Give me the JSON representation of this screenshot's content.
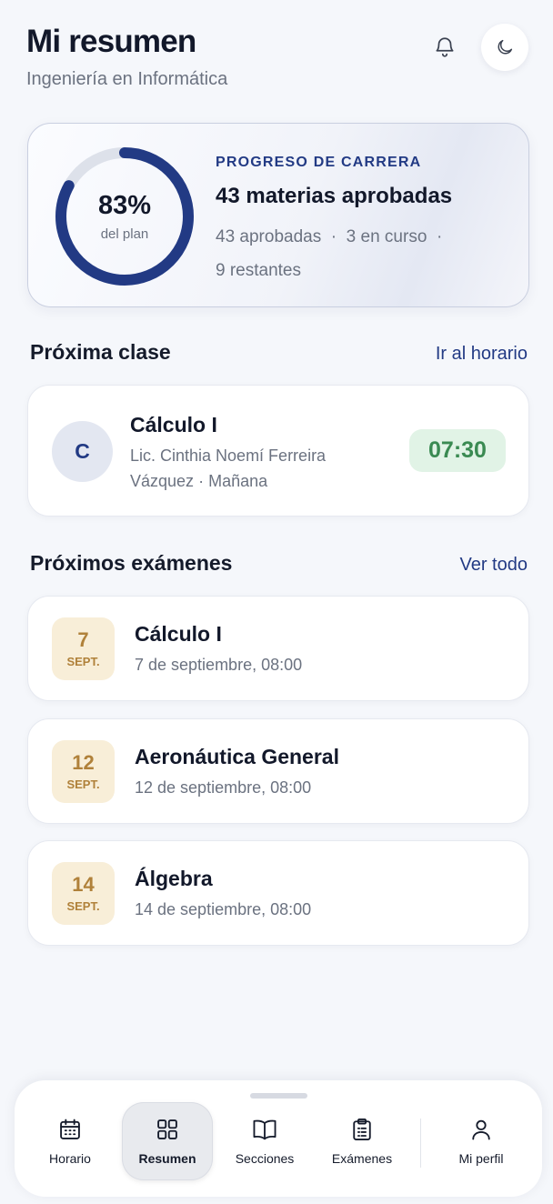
{
  "header": {
    "title": "Mi resumen",
    "subtitle": "Ingeniería en Informática",
    "bell_icon": "bell-icon",
    "theme_icon": "moon-icon"
  },
  "progress": {
    "percent_label": "83%",
    "percent_value": 83,
    "ring_caption": "del plan",
    "eyebrow": "PROGRESO DE CARRERA",
    "title": "43 materias aprobadas",
    "approved": "43 aprobadas",
    "in_course": "3 en curso",
    "remaining": "9 restantes",
    "separator": "·"
  },
  "next_class": {
    "section_title": "Próxima clase",
    "link": "Ir al horario",
    "initial": "C",
    "course": "Cálculo I",
    "teacher": "Lic. Cinthia Noemí Ferreira Vázquez",
    "shift": "Mañana",
    "separator": "·",
    "time": "07:30"
  },
  "exams": {
    "section_title": "Próximos exámenes",
    "link": "Ver todo",
    "items": [
      {
        "day": "7",
        "month": "SEPT.",
        "course": "Cálculo I",
        "datetime": "7 de septiembre, 08:00"
      },
      {
        "day": "12",
        "month": "SEPT.",
        "course": "Aeronáutica General",
        "datetime": "12 de septiembre, 08:00"
      },
      {
        "day": "14",
        "month": "SEPT.",
        "course": "Álgebra",
        "datetime": "14 de septiembre, 08:00"
      }
    ]
  },
  "tabbar": {
    "tabs": [
      {
        "label": "Horario",
        "icon": "calendar-icon",
        "active": false
      },
      {
        "label": "Resumen",
        "icon": "grid-icon",
        "active": true
      },
      {
        "label": "Secciones",
        "icon": "book-icon",
        "active": false
      },
      {
        "label": "Exámenes",
        "icon": "clipboard-icon",
        "active": false
      },
      {
        "label": "Mi perfil",
        "icon": "user-icon",
        "active": false
      }
    ]
  },
  "colors": {
    "accent": "#223a84",
    "ring_track": "#dde1ea",
    "time_badge_bg": "#e1f3e6",
    "time_badge_text": "#3a8a52",
    "date_chip_bg": "#f8eed8",
    "date_chip_text": "#b0813a"
  }
}
